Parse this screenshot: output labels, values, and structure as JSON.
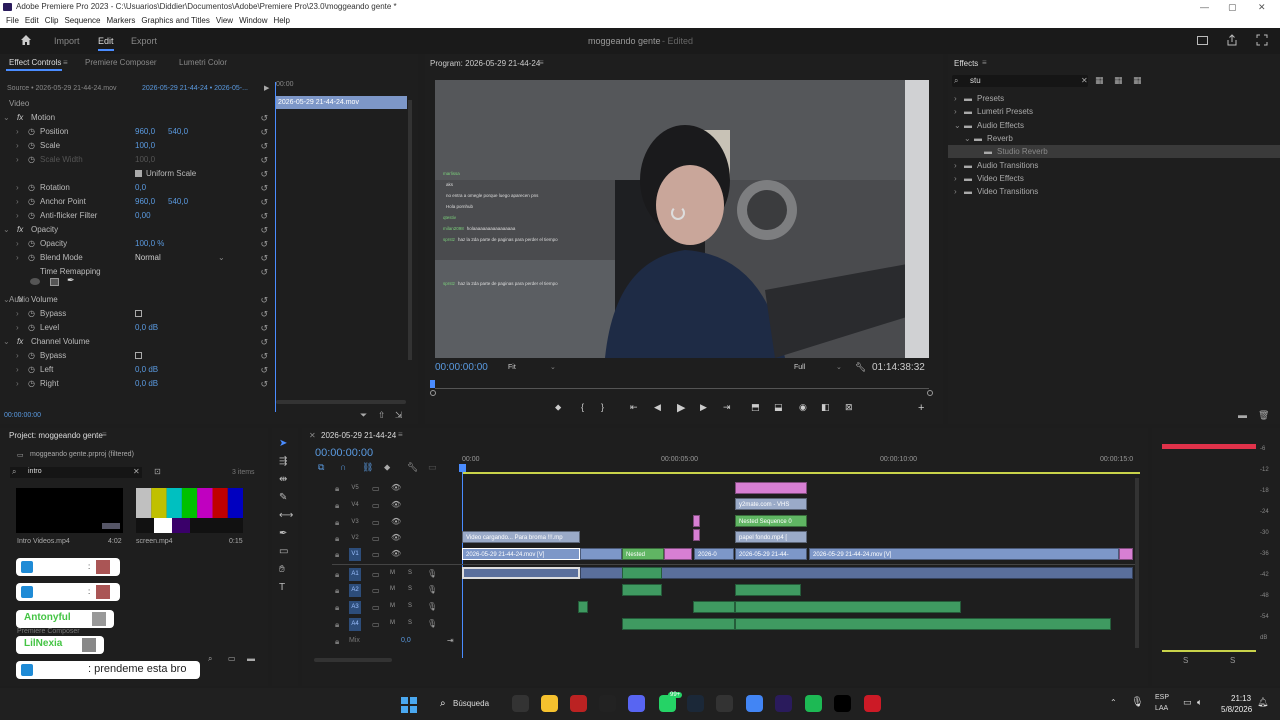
{
  "window": {
    "title": "Adobe Premiere Pro 2023 - C:\\Usuarios\\Diddier\\Documentos\\Adobe\\Premiere Pro\\23.0\\moggeando gente *",
    "menu": [
      "File",
      "Edit",
      "Clip",
      "Sequence",
      "Markers",
      "Graphics and Titles",
      "View",
      "Window",
      "Help"
    ]
  },
  "workspace": {
    "tabs": [
      "Import",
      "Edit",
      "Export"
    ],
    "active": "Edit",
    "project_title": "moggeando gente",
    "status": " - Edited"
  },
  "effect_controls": {
    "tabs": [
      "Effect Controls",
      "Premiere Composer",
      "Lumetri Color"
    ],
    "source": "Source • 2026-05-29 21-44-24.mov",
    "sequence": "2026-05-29 21-44-24 • 2026-05-...",
    "timeline_clip": "2026-05-29 21-44-24.mov",
    "timecode_top": "00:00",
    "sections": {
      "video": "Video",
      "audio": "Audio"
    },
    "rows": [
      {
        "label": "Motion",
        "fx": true
      },
      {
        "label": "Position",
        "v1": "960,0",
        "v2": "540,0"
      },
      {
        "label": "Scale",
        "v1": "100,0"
      },
      {
        "label": "Scale Width",
        "v1": "100,0",
        "dim": true
      },
      {
        "label": "Uniform Scale",
        "check": true
      },
      {
        "label": "Rotation",
        "v1": "0,0"
      },
      {
        "label": "Anchor Point",
        "v1": "960,0",
        "v2": "540,0"
      },
      {
        "label": "Anti-flicker Filter",
        "v1": "0,00"
      },
      {
        "label": "Opacity",
        "fx": true
      },
      {
        "label": "Opacity",
        "v1": "100,0 %"
      },
      {
        "label": "Blend Mode",
        "v1": "Normal"
      },
      {
        "label": "Time Remapping"
      },
      {
        "label": "Volume",
        "fx": true
      },
      {
        "label": "Bypass"
      },
      {
        "label": "Level",
        "v1": "0,0 dB"
      },
      {
        "label": "Channel Volume",
        "fx": true
      },
      {
        "label": "Bypass"
      },
      {
        "label": "Left",
        "v1": "0,0 dB"
      },
      {
        "label": "Right",
        "v1": "0,0 dB"
      }
    ],
    "timecode_bottom": "00:00:00:00"
  },
  "program": {
    "title": "Program: 2026-05-29 21-44-24",
    "timecode": "00:00:00:00",
    "fit": "Fit",
    "quality": "Full",
    "duration": "01:14:38:32",
    "chat": [
      {
        "user": "marlissa",
        "msg": ""
      },
      {
        "user": "",
        "msg": "aks"
      },
      {
        "user": "",
        "msg": "no entra a omegle porque luego aparecen pns"
      },
      {
        "user": "",
        "msg": "Hola pornhub"
      },
      {
        "user": "qtestiv",
        "msg": ""
      },
      {
        "user": "milan2098",
        "msg": "holaaaaaaaaaaaaaaaaa"
      },
      {
        "user": "sprstz",
        "msg": "haz la 2da parte de paginas para perder el tiempo"
      },
      {
        "user": "",
        "msg": ""
      },
      {
        "user": "",
        "msg": ""
      },
      {
        "user": "",
        "msg": ""
      },
      {
        "user": "sprstz",
        "msg": "haz la 2da parte de paginas para perder el tiempo"
      }
    ]
  },
  "effects": {
    "title": "Effects",
    "search": "stu",
    "tree": [
      {
        "label": "Presets",
        "level": 0
      },
      {
        "label": "Lumetri Presets",
        "level": 0
      },
      {
        "label": "Audio Effects",
        "level": 0
      },
      {
        "label": "Reverb",
        "level": 1
      },
      {
        "label": "Studio Reverb",
        "level": 2,
        "selected": true
      },
      {
        "label": "Audio Transitions",
        "level": 0
      },
      {
        "label": "Video Effects",
        "level": 0
      },
      {
        "label": "Video Transitions",
        "level": 0
      }
    ]
  },
  "project": {
    "title": "Project: moggeando gente",
    "file": "moggeando gente.prproj (filtered)",
    "search": "intro",
    "count": "3 items",
    "items": [
      {
        "name": "Intro Videos.mp4",
        "duration": "4:02"
      },
      {
        "name": "screen.mp4",
        "duration": "0:15"
      }
    ],
    "footer": "Premiere Composer"
  },
  "timeline": {
    "title": "2026-05-29 21-44-24",
    "timecode": "00:00:00:00",
    "ruler": [
      "00:00",
      "00:00:05:00",
      "00:00:10:00",
      "00:00:15:0"
    ],
    "video_tracks": [
      "V5",
      "V4",
      "V3",
      "V2",
      "V1"
    ],
    "audio_tracks": [
      "A1",
      "A2",
      "A3",
      "A4"
    ],
    "mix_label": "Mix",
    "mix_value": "0,0",
    "clips": {
      "v4": "y2mate.com - VHS",
      "v3": "Nested Sequence 0",
      "v2a": "Video cargando... Para broma !!!.mp",
      "v2b": "papel fondo.mp4 [",
      "v1a": "2026-05-29 21-44-24.mov [V]",
      "v1b": "Nested",
      "v1c": "2026-0",
      "v1d": "2026-05-29 21-44-",
      "v1e": "2026-05-29 21-44-24.mov [V]"
    }
  },
  "meters": {
    "ticks": [
      "-6",
      "-12",
      "-18",
      "-24",
      "-30",
      "-36",
      "-42",
      "-48",
      "-54",
      "dB"
    ],
    "s": "S"
  },
  "overlay": {
    "users": [
      "Antonyful",
      "LilNexia"
    ],
    "message": ": prendeme esta bro"
  },
  "taskbar": {
    "search": "Búsqueda",
    "lang1": "ESP",
    "lang2": "LAA",
    "time": "21:13",
    "date": "5/8/2026",
    "badge": "99+"
  },
  "colors": {
    "accent_blue": "#5a9ae0",
    "playhead": "#4a8cff",
    "video_clip": "#7d97c8",
    "nested_clip": "#60b563",
    "pink_clip": "#d77fd3",
    "audio_clip": "#3f9a61"
  }
}
